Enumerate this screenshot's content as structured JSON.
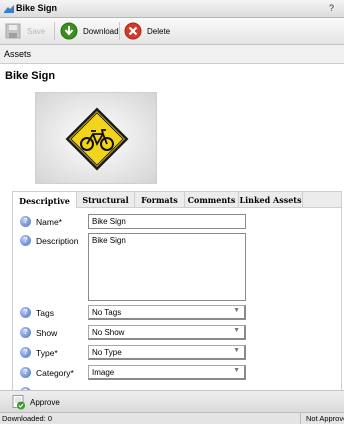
{
  "window": {
    "title": "Bike Sign",
    "help": "?"
  },
  "toolbar": {
    "save_label": "Save",
    "download_label": "Download",
    "delete_label": "Delete"
  },
  "breadcrumb": {
    "label": "Assets"
  },
  "asset": {
    "title": "Bike Sign"
  },
  "tabs": [
    {
      "label": "Descriptive",
      "active": true
    },
    {
      "label": "Structural"
    },
    {
      "label": "Formats"
    },
    {
      "label": "Comments"
    },
    {
      "label": "Linked Assets"
    }
  ],
  "fields": {
    "name": {
      "label": "Name*",
      "value": "Bike Sign"
    },
    "description": {
      "label": "Description",
      "value": "Bike Sign"
    },
    "tags": {
      "label": "Tags",
      "value": "No Tags"
    },
    "show": {
      "label": "Show",
      "value": "No Show"
    },
    "type": {
      "label": "Type*",
      "value": "No Type"
    },
    "category": {
      "label": "Category*",
      "value": "Image"
    }
  },
  "approve": {
    "label": "Approve"
  },
  "status": {
    "downloaded": "Downloaded: 0",
    "approval": "Not Approved"
  },
  "colors": {
    "sign_yellow": "#f2d51a",
    "download_green": "#3a8f1e",
    "delete_red": "#d23a2a",
    "help_blue": "#4a6fc4"
  }
}
